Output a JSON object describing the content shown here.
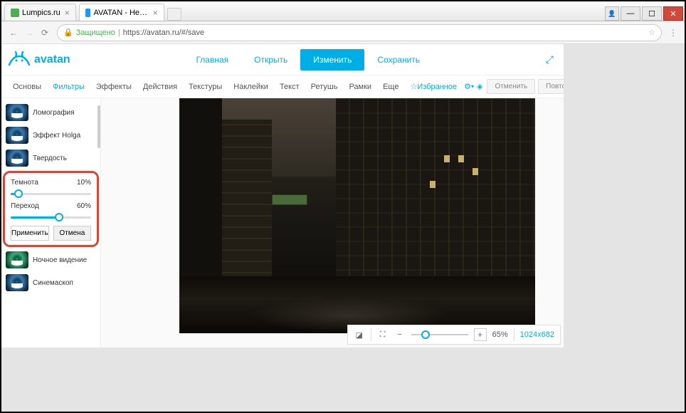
{
  "browser": {
    "tabs": [
      {
        "title": "Lumpics.ru"
      },
      {
        "title": "AVATAN - Необычный С"
      }
    ],
    "secure_label": "Защищено",
    "url": "https://avatan.ru/#/save"
  },
  "header": {
    "logo": "avatan",
    "nav": {
      "home": "Главная",
      "open": "Открыть",
      "edit": "Изменить",
      "save": "Сохранить"
    }
  },
  "toolbar": {
    "items": [
      "Основы",
      "Фильтры",
      "Эффекты",
      "Действия",
      "Текстуры",
      "Наклейки",
      "Текст",
      "Ретушь",
      "Рамки",
      "Еще"
    ],
    "favorites": "Избранное",
    "undo": "Отменить",
    "redo": "Повторить"
  },
  "filters": {
    "list": [
      "Ломография",
      "Эффект Holga",
      "Твердость",
      "Ночное видение",
      "Синемаскоп"
    ],
    "panel": {
      "darkness_label": "Темнота",
      "darkness_value": "10%",
      "darkness_pct": 10,
      "transition_label": "Переход",
      "transition_value": "60%",
      "transition_pct": 60,
      "apply": "Применить",
      "cancel": "Отмена"
    }
  },
  "zoom": {
    "value": "65%",
    "dimensions": "1024x682"
  }
}
